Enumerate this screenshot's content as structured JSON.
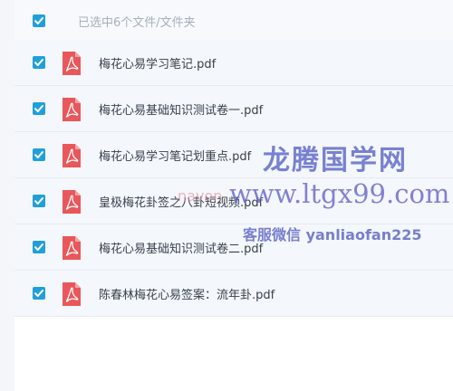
{
  "header": {
    "selected_text": "已选中6个文件/文件夹",
    "select_all_checked": true
  },
  "files": [
    {
      "name": "梅花心易学习笔记.pdf",
      "checked": true,
      "icon": "pdf-file-icon"
    },
    {
      "name": "梅花心易基础知识测试卷一.pdf",
      "checked": true,
      "icon": "pdf-file-icon"
    },
    {
      "name": "梅花心易学习笔记划重点.pdf",
      "checked": true,
      "icon": "pdf-file-icon"
    },
    {
      "name": "皇极梅花卦签之八卦短视频.pdf",
      "checked": true,
      "icon": "pdf-file-icon"
    },
    {
      "name": "梅花心易基础知识测试卷二.pdf",
      "checked": true,
      "icon": "pdf-file-icon"
    },
    {
      "name": "陈春林梅花心易签案：流年卦.pdf",
      "checked": true,
      "icon": "pdf-file-icon"
    }
  ],
  "watermark": {
    "title": "龙腾国学网",
    "url": "www.ltgx99.com",
    "faint": "navon",
    "contact": "客服微信 yanliaofan225"
  },
  "colors": {
    "checkbox": "#21a0d8",
    "pdf_icon": "#e9575a",
    "row_bg": "#f4f7fb",
    "watermark": "#6771c9"
  }
}
